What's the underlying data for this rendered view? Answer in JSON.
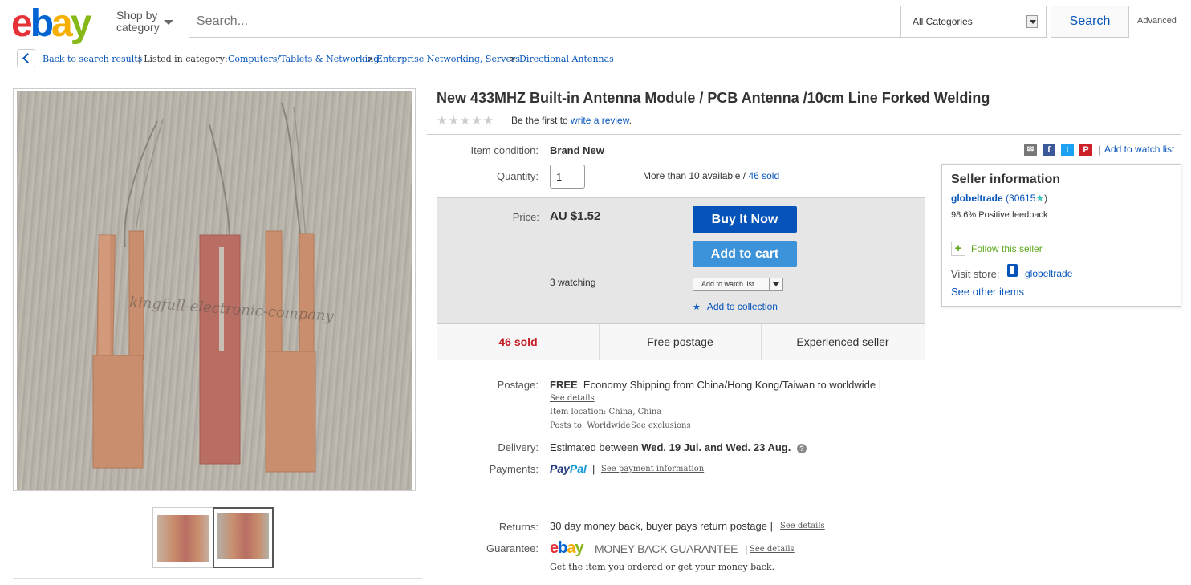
{
  "header": {
    "logo_letters": [
      "e",
      "b",
      "a",
      "y"
    ],
    "shop_by_line1": "Shop by",
    "shop_by_line2": "category",
    "search_placeholder": "Search...",
    "category_select": "All Categories",
    "search_button": "Search",
    "advanced": "Advanced"
  },
  "breadcrumb": {
    "back": "Back to search results",
    "listed_in": "| Listed in category:",
    "items": [
      "Computers/Tablets & Networking",
      "Enterprise Networking, Servers",
      "Directional Antennas"
    ],
    "separator": ">"
  },
  "listing": {
    "watermark": "kingfull-electronic-company",
    "title": "New 433MHZ Built-in Antenna Module / PCB Antenna /10cm Line Forked Welding",
    "stars": "★★★★★",
    "review_prefix": "Be the first to",
    "review_link": "write a review",
    "review_suffix": ".",
    "condition_label": "Item condition:",
    "condition_value": "Brand New",
    "quantity_label": "Quantity:",
    "quantity_value": "1",
    "availability": "More than 10 available /",
    "sold_link": "46 sold"
  },
  "purchase": {
    "price_label": "Price:",
    "price": "AU $1.52",
    "buy_now": "Buy It Now",
    "add_to_cart": "Add to cart",
    "watching": "3 watching",
    "add_watch_list": "Add to watch list",
    "add_collection": "Add to collection",
    "collection_star": "★",
    "cells": [
      "46 sold",
      "Free postage",
      "Experienced seller"
    ]
  },
  "shipping": {
    "postage_label": "Postage:",
    "postage_free": "FREE",
    "postage_text": "Economy Shipping from China/Hong Kong/Taiwan to worldwide |",
    "see_details": "See details",
    "item_location": "Item location:  China, China",
    "posts_to": "Posts to:  Worldwide",
    "see_exclusions": "See exclusions",
    "delivery_label": "Delivery:",
    "delivery_prefix": "Estimated between",
    "delivery_dates": "Wed. 19 Jul. and Wed. 23 Aug.",
    "help_icon": "?",
    "payments_label": "Payments:",
    "paypal_1": "Pay",
    "paypal_2": "Pal",
    "payment_sep": "|",
    "payment_info": "See payment information",
    "returns_label": "Returns:",
    "returns_text": "30 day money back, buyer pays return postage |",
    "returns_details": "See details",
    "guarantee_label": "Guarantee:",
    "guarantee_mark": "MONEY BACK GUARANTEE",
    "guarantee_sep": "|",
    "guarantee_details": "See details",
    "guarantee_text": "Get the item you ordered or get your money back."
  },
  "seller": {
    "share_icons": [
      "✉",
      "f",
      "t",
      "P"
    ],
    "add_watch": "Add to watch list",
    "share_sep": "|",
    "heading": "Seller information",
    "name": "globeltrade",
    "score": "(30615",
    "score_star": "★",
    "score_close": ")",
    "feedback": "98.6% Positive feedback",
    "follow_icon": "+",
    "follow": "Follow this seller",
    "visit_store": "Visit store:",
    "store_name": "globeltrade",
    "other_items": "See other items"
  },
  "colors": {
    "link": "#0654ba",
    "buy_now": "#0654ba",
    "add_to_cart": "#3d93d9",
    "sold": "#c51e24",
    "follow": "#5ba71b"
  }
}
